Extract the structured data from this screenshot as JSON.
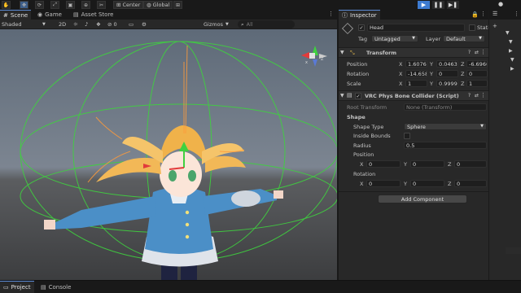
{
  "toolbar": {
    "pivot_label": "Center",
    "space_label": "Global"
  },
  "scene": {
    "tabs": [
      {
        "label": "Scene",
        "icon": "scene-icon"
      },
      {
        "label": "Game",
        "icon": "game-icon"
      },
      {
        "label": "Asset Store",
        "icon": "asset-store-icon"
      }
    ],
    "shading_mode": "Shaded",
    "mode_2d": "2D",
    "hidden_count": "0",
    "gizmos_label": "Gizmos",
    "search_placeholder": "All"
  },
  "inspector": {
    "tab_label": "Inspector",
    "object_name": "Head",
    "static_label": "Static",
    "tag_label": "Tag",
    "tag_value": "Untagged",
    "layer_label": "Layer",
    "layer_value": "Default",
    "transform": {
      "title": "Transform",
      "position_label": "Position",
      "rotation_label": "Rotation",
      "scale_label": "Scale",
      "position": {
        "x": "1.6076(",
        "y": "0.0463",
        "z": "-6.696("
      },
      "rotation": {
        "x": "-14.658",
        "y": "0",
        "z": "0"
      },
      "scale": {
        "x": "1",
        "y": "0.9999(",
        "z": "1"
      }
    },
    "collider": {
      "title": "VRC Phys Bone Collider (Script)",
      "root_transform_label": "Root Transform",
      "root_transform_value": "None (Transform)",
      "shape_heading": "Shape",
      "shape_type_label": "Shape Type",
      "shape_type_value": "Sphere",
      "inside_bounds_label": "Inside Bounds",
      "radius_label": "Radius",
      "radius_value": "0.5",
      "position_label": "Position",
      "position": {
        "x": "0",
        "y": "0",
        "z": "0"
      },
      "rotation_label": "Rotation",
      "rotation": {
        "x": "0",
        "y": "0",
        "z": "0"
      }
    },
    "add_component_label": "Add Component",
    "axis_x": "X",
    "axis_y": "Y",
    "axis_z": "Z"
  },
  "bottom": {
    "tabs": [
      {
        "label": "Project",
        "icon": "folder-icon"
      },
      {
        "label": "Console",
        "icon": "console-icon"
      }
    ]
  },
  "colors": {
    "accent": "#3d7bd1",
    "gizmo_green": "#3fd13f",
    "panel_bg": "#282828"
  }
}
